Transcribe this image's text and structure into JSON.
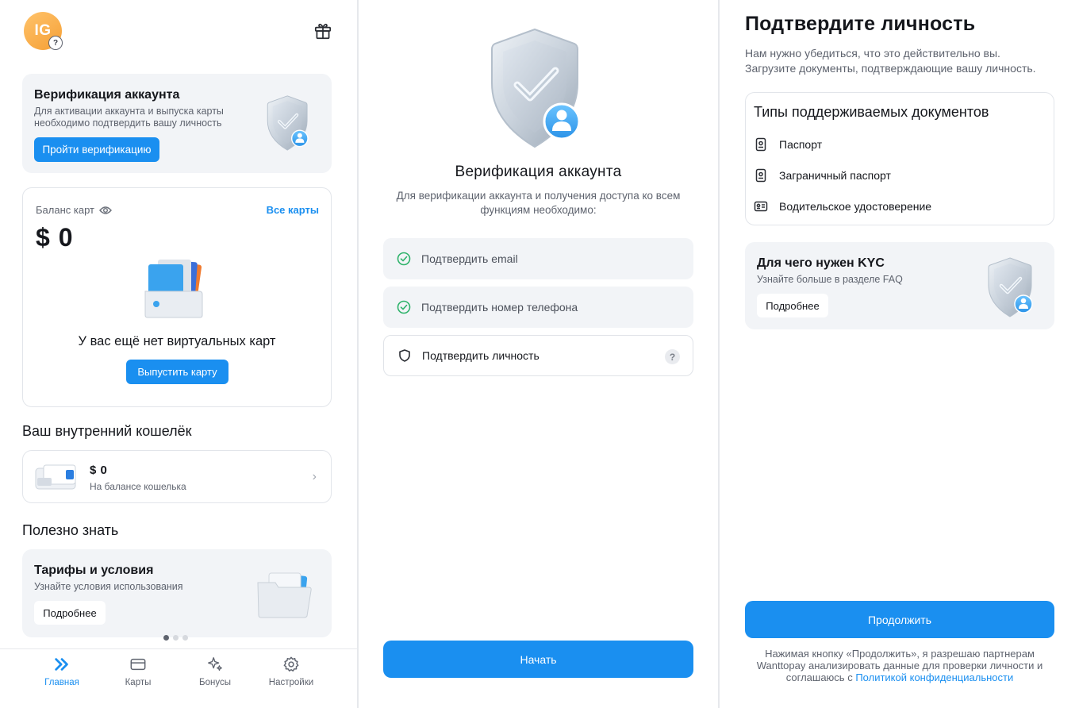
{
  "home": {
    "avatar_initials": "IG",
    "avatar_badge": "?",
    "verification_card": {
      "title": "Верификация аккаунта",
      "description": "Для активации аккаунта и выпуска карты необходимо подтвердить вашу личность",
      "button": "Пройти верификацию"
    },
    "balance_card": {
      "label": "Баланс карт",
      "all_cards_link": "Все карты",
      "amount": "$ 0",
      "empty_text": "У вас ещё нет виртуальных карт",
      "button": "Выпустить карту"
    },
    "wallet_section": {
      "title": "Ваш внутренний кошелёк",
      "amount": "$ 0",
      "subtitle": "На балансе кошелька"
    },
    "useful_section": {
      "title": "Полезно знать",
      "card_title": "Тарифы и условия",
      "card_subtitle": "Узнайте условия использования",
      "card_button": "Подробнее",
      "pager_count": 3,
      "pager_active": 1
    },
    "tabbar": [
      {
        "label": "Главная",
        "icon": "home-chevrons-icon",
        "active": true
      },
      {
        "label": "Карты",
        "icon": "card-icon",
        "active": false
      },
      {
        "label": "Бонусы",
        "icon": "sparkles-icon",
        "active": false
      },
      {
        "label": "Настройки",
        "icon": "gear-icon",
        "active": false
      }
    ]
  },
  "verification": {
    "title": "Верификация аккаунта",
    "description": "Для верификации аккаунта и получения доступа ко всем функциям необходимо:",
    "steps": [
      {
        "label": "Подтвердить email",
        "status": "done"
      },
      {
        "label": "Подтвердить номер телефона",
        "status": "done"
      },
      {
        "label": "Подтвердить личность",
        "status": "pending",
        "help": "?"
      }
    ],
    "start_button": "Начать"
  },
  "kyc": {
    "title": "Подтвердите личность",
    "description_line1": "Нам нужно убедиться, что это действительно вы.",
    "description_line2": "Загрузите документы, подтверждающие вашу личность.",
    "docs_title": "Типы поддерживаемых документов",
    "docs": [
      "Паспорт",
      "Заграничный паспорт",
      "Водительское удостоверение"
    ],
    "faq_card": {
      "title": "Для чего нужен KYC",
      "subtitle": "Узнайте больше в разделе FAQ",
      "button": "Подробнее"
    },
    "continue_button": "Продолжить",
    "legal_text": "Нажимая кнопку «Продолжить», я разрешаю партнерам Wanttopay анализировать данные для проверки личности и соглашаюсь с",
    "legal_link": "Политикой конфиденциальности"
  },
  "colors": {
    "accent": "#1a8ff0",
    "card_bg": "#f2f4f7",
    "success": "#2fb36b",
    "avatar": "#f5a53c"
  }
}
